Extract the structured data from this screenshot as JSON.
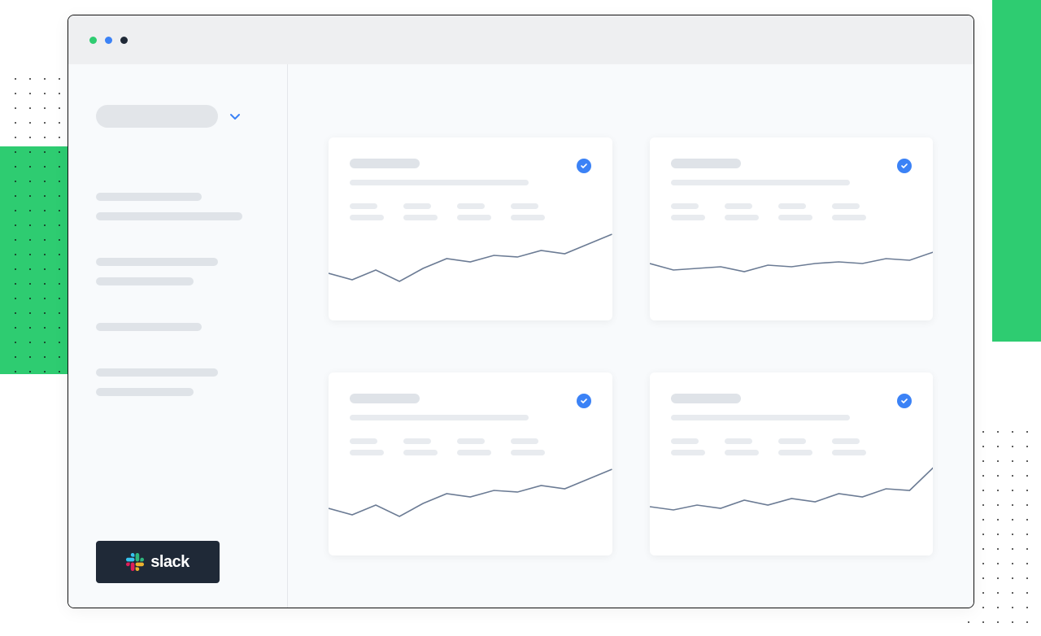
{
  "window": {
    "dots": [
      "green",
      "blue",
      "dark"
    ]
  },
  "sidebar": {
    "dropdown_icon": "chevron-down",
    "groups": [
      {
        "lines": [
          "w1",
          "w2"
        ]
      },
      {
        "lines": [
          "w3",
          "w4"
        ]
      },
      {
        "lines": [
          "w1"
        ]
      },
      {
        "lines": [
          "w3",
          "w4"
        ]
      }
    ],
    "slack_label": "slack"
  },
  "cards": [
    {
      "badge": "check",
      "chart_variant": 0
    },
    {
      "badge": "check",
      "chart_variant": 1
    },
    {
      "badge": "check",
      "chart_variant": 0
    },
    {
      "badge": "check",
      "chart_variant": 2
    }
  ],
  "chart_data": [
    {
      "type": "line",
      "x": [
        0,
        1,
        2,
        3,
        4,
        5,
        6,
        7,
        8,
        9,
        10,
        11,
        12
      ],
      "values": [
        62,
        70,
        58,
        72,
        56,
        44,
        48,
        40,
        42,
        34,
        38,
        26,
        14
      ],
      "title": "",
      "xlabel": "",
      "ylabel": "",
      "ylim": [
        0,
        120
      ]
    },
    {
      "type": "line",
      "x": [
        0,
        1,
        2,
        3,
        4,
        5,
        6,
        7,
        8,
        9,
        10,
        11,
        12
      ],
      "values": [
        50,
        58,
        56,
        54,
        60,
        52,
        54,
        50,
        48,
        50,
        44,
        46,
        36
      ],
      "title": "",
      "xlabel": "",
      "ylabel": "",
      "ylim": [
        0,
        120
      ]
    },
    {
      "type": "line",
      "x": [
        0,
        1,
        2,
        3,
        4,
        5,
        6,
        7,
        8,
        9,
        10,
        11,
        12
      ],
      "values": [
        60,
        64,
        58,
        62,
        52,
        58,
        50,
        54,
        44,
        48,
        38,
        40,
        12
      ],
      "title": "",
      "xlabel": "",
      "ylabel": "",
      "ylim": [
        0,
        120
      ]
    }
  ],
  "colors": {
    "accent": "#3b82f6",
    "line": "#6b7b94"
  }
}
